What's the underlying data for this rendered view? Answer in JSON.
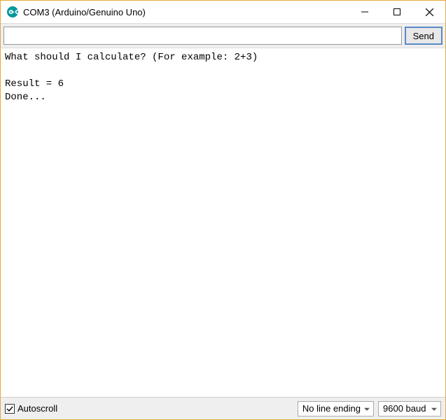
{
  "window": {
    "title": "COM3 (Arduino/Genuino Uno)"
  },
  "toolbar": {
    "input_value": "",
    "input_placeholder": "",
    "send_label": "Send"
  },
  "console": {
    "output": "What should I calculate? (For example: 2+3)\n\nResult = 6\nDone..."
  },
  "statusbar": {
    "autoscroll_label": "Autoscroll",
    "autoscroll_checked": true,
    "line_ending": {
      "selected": "No line ending"
    },
    "baud_rate": {
      "selected": "9600 baud"
    }
  },
  "colors": {
    "arduino_teal": "#00979d",
    "window_border": "#e8a838"
  }
}
